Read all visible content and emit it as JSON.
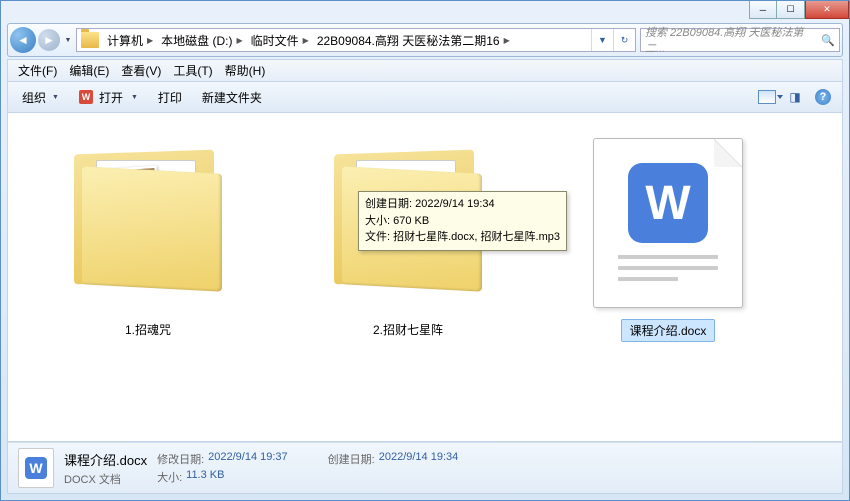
{
  "breadcrumb": {
    "items": [
      "计算机",
      "本地磁盘 (D:)",
      "临时文件",
      "22B09084.高翔 天医秘法第二期16"
    ]
  },
  "search": {
    "placeholder": "搜索 22B09084.高翔 天医秘法第二..."
  },
  "menubar": {
    "file": "文件(F)",
    "edit": "编辑(E)",
    "view": "查看(V)",
    "tools": "工具(T)",
    "help": "帮助(H)"
  },
  "toolbar": {
    "organize": "组织",
    "open": "打开",
    "print": "打印",
    "newfolder": "新建文件夹"
  },
  "items": [
    {
      "label": "1.招魂咒"
    },
    {
      "label": "2.招财七星阵"
    },
    {
      "label": "课程介绍.docx"
    }
  ],
  "tooltip": {
    "line1": "创建日期: 2022/9/14 19:34",
    "line2": "大小: 670 KB",
    "line3": "文件: 招财七星阵.docx, 招财七星阵.mp3"
  },
  "details": {
    "name": "课程介绍.docx",
    "type": "DOCX 文档",
    "modified_label": "修改日期:",
    "modified": "2022/9/14 19:37",
    "size_label": "大小:",
    "size": "11.3 KB",
    "created_label": "创建日期:",
    "created": "2022/9/14 19:34"
  }
}
